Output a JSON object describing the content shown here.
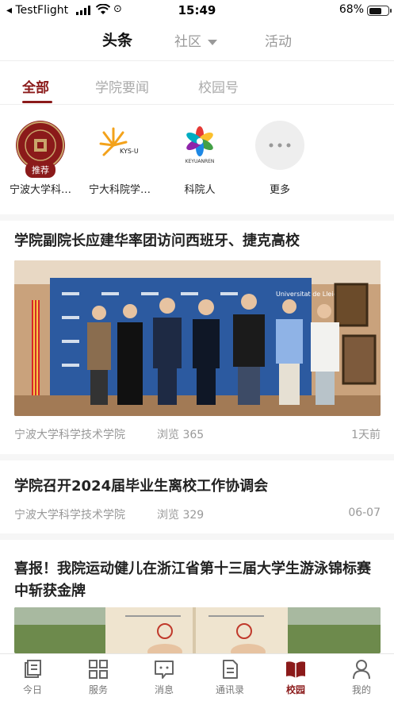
{
  "status_bar": {
    "back_app": "TestFlight",
    "time": "15:49",
    "battery": "68%",
    "battery_level": 0.68
  },
  "top_tabs": {
    "tab1": "头条",
    "tab2": "社区",
    "tab3": "活动"
  },
  "sub_tabs": {
    "tab1": "全部",
    "tab2": "学院要闻",
    "tab3": "校园号"
  },
  "channels": [
    {
      "label": "宁波大学科…",
      "badge": "推荐"
    },
    {
      "label": "宁大科院学…",
      "logo_text": "KYS-U"
    },
    {
      "label": "科院人",
      "logo_text": "KEYUANREN"
    },
    {
      "label": "更多"
    }
  ],
  "articles": [
    {
      "title": "学院副院长应建华率团访问西班牙、捷克高校",
      "source": "宁波大学科学技术学院",
      "views": "浏览 365",
      "date": "1天前",
      "banner_text": "Universitat de Lleida"
    },
    {
      "title": "学院召开2024届毕业生离校工作协调会",
      "source": "宁波大学科学技术学院",
      "views": "浏览 329",
      "date": "06-07"
    },
    {
      "title": "喜报！我院运动健儿在浙江省第十三届大学生游泳锦标赛中斩获金牌"
    }
  ],
  "bottom_nav": [
    {
      "label": "今日"
    },
    {
      "label": "服务"
    },
    {
      "label": "消息"
    },
    {
      "label": "通讯录"
    },
    {
      "label": "校园"
    },
    {
      "label": "我的"
    }
  ],
  "colors": {
    "accent": "#8b1a1a"
  }
}
